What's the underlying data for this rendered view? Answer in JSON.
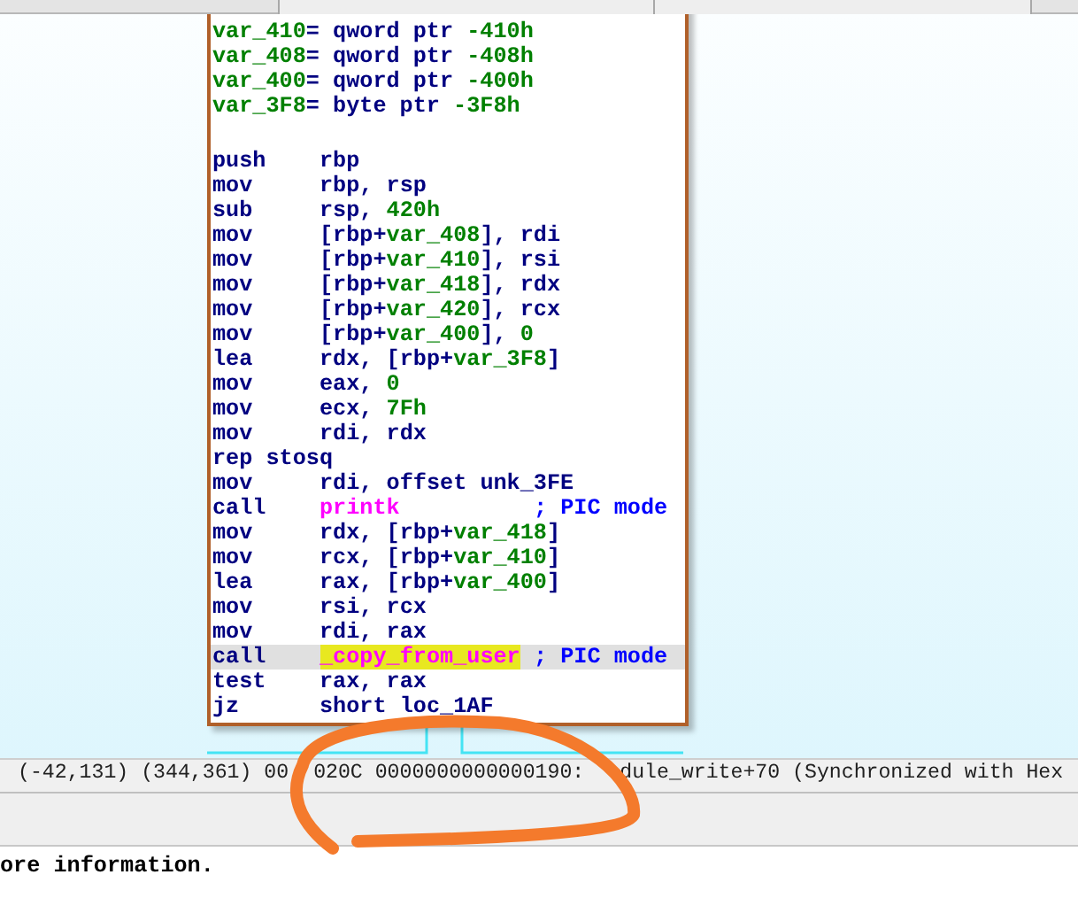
{
  "code_block": {
    "lines": [
      {
        "kind": "decl",
        "segments": [
          {
            "text": "var_410",
            "kind": "var"
          },
          {
            "text": "= qword ptr ",
            "kind": "plain"
          },
          {
            "text": "-410h",
            "kind": "num"
          }
        ]
      },
      {
        "kind": "decl",
        "segments": [
          {
            "text": "var_408",
            "kind": "var"
          },
          {
            "text": "= qword ptr ",
            "kind": "plain"
          },
          {
            "text": "-408h",
            "kind": "num"
          }
        ]
      },
      {
        "kind": "decl",
        "segments": [
          {
            "text": "var_400",
            "kind": "var"
          },
          {
            "text": "= qword ptr ",
            "kind": "plain"
          },
          {
            "text": "-400h",
            "kind": "num"
          }
        ]
      },
      {
        "kind": "decl",
        "segments": [
          {
            "text": "var_3F8",
            "kind": "var"
          },
          {
            "text": "= byte ptr ",
            "kind": "plain"
          },
          {
            "text": "-3F8h",
            "kind": "num"
          }
        ]
      },
      {
        "kind": "blank"
      },
      {
        "kind": "insn",
        "mnemonic": "push",
        "segments": [
          {
            "text": "rbp",
            "kind": "plain"
          }
        ]
      },
      {
        "kind": "insn",
        "mnemonic": "mov",
        "segments": [
          {
            "text": "rbp, rsp",
            "kind": "plain"
          }
        ]
      },
      {
        "kind": "insn",
        "mnemonic": "sub",
        "segments": [
          {
            "text": "rsp, ",
            "kind": "plain"
          },
          {
            "text": "420h",
            "kind": "num"
          }
        ]
      },
      {
        "kind": "insn",
        "mnemonic": "mov",
        "segments": [
          {
            "text": "[rbp+",
            "kind": "plain"
          },
          {
            "text": "var_408",
            "kind": "var"
          },
          {
            "text": "], rdi",
            "kind": "plain"
          }
        ]
      },
      {
        "kind": "insn",
        "mnemonic": "mov",
        "segments": [
          {
            "text": "[rbp+",
            "kind": "plain"
          },
          {
            "text": "var_410",
            "kind": "var"
          },
          {
            "text": "], rsi",
            "kind": "plain"
          }
        ]
      },
      {
        "kind": "insn",
        "mnemonic": "mov",
        "segments": [
          {
            "text": "[rbp+",
            "kind": "plain"
          },
          {
            "text": "var_418",
            "kind": "var"
          },
          {
            "text": "], rdx",
            "kind": "plain"
          }
        ]
      },
      {
        "kind": "insn",
        "mnemonic": "mov",
        "segments": [
          {
            "text": "[rbp+",
            "kind": "plain"
          },
          {
            "text": "var_420",
            "kind": "var"
          },
          {
            "text": "], rcx",
            "kind": "plain"
          }
        ]
      },
      {
        "kind": "insn",
        "mnemonic": "mov",
        "segments": [
          {
            "text": "[rbp+",
            "kind": "plain"
          },
          {
            "text": "var_400",
            "kind": "var"
          },
          {
            "text": "], ",
            "kind": "plain"
          },
          {
            "text": "0",
            "kind": "num"
          }
        ]
      },
      {
        "kind": "insn",
        "mnemonic": "lea",
        "segments": [
          {
            "text": "rdx, [rbp+",
            "kind": "plain"
          },
          {
            "text": "var_3F8",
            "kind": "var"
          },
          {
            "text": "]",
            "kind": "plain"
          }
        ]
      },
      {
        "kind": "insn",
        "mnemonic": "mov",
        "segments": [
          {
            "text": "eax, ",
            "kind": "plain"
          },
          {
            "text": "0",
            "kind": "num"
          }
        ]
      },
      {
        "kind": "insn",
        "mnemonic": "mov",
        "segments": [
          {
            "text": "ecx, ",
            "kind": "plain"
          },
          {
            "text": "7Fh",
            "kind": "num"
          }
        ]
      },
      {
        "kind": "insn",
        "mnemonic": "mov",
        "segments": [
          {
            "text": "rdi, rdx",
            "kind": "plain"
          }
        ]
      },
      {
        "kind": "insn",
        "mnemonic": "rep stosq"
      },
      {
        "kind": "insn",
        "mnemonic": "mov",
        "segments": [
          {
            "text": "rdi, offset unk_3FE",
            "kind": "plain"
          }
        ]
      },
      {
        "kind": "insn",
        "mnemonic": "call",
        "segments": [
          {
            "text": "printk",
            "kind": "func"
          }
        ],
        "comment": "; PIC mode"
      },
      {
        "kind": "insn",
        "mnemonic": "mov",
        "segments": [
          {
            "text": "rdx, [rbp+",
            "kind": "plain"
          },
          {
            "text": "var_418",
            "kind": "var"
          },
          {
            "text": "]",
            "kind": "plain"
          }
        ]
      },
      {
        "kind": "insn",
        "mnemonic": "mov",
        "segments": [
          {
            "text": "rcx, [rbp+",
            "kind": "plain"
          },
          {
            "text": "var_410",
            "kind": "var"
          },
          {
            "text": "]",
            "kind": "plain"
          }
        ]
      },
      {
        "kind": "insn",
        "mnemonic": "lea",
        "segments": [
          {
            "text": "rax, [rbp+",
            "kind": "plain"
          },
          {
            "text": "var_400",
            "kind": "var"
          },
          {
            "text": "]",
            "kind": "plain"
          }
        ]
      },
      {
        "kind": "insn",
        "mnemonic": "mov",
        "segments": [
          {
            "text": "rsi, rcx",
            "kind": "plain"
          }
        ]
      },
      {
        "kind": "insn",
        "mnemonic": "mov",
        "segments": [
          {
            "text": "rdi, rax",
            "kind": "plain"
          }
        ]
      },
      {
        "kind": "insn",
        "mnemonic": "call",
        "selected": true,
        "segments": [
          {
            "text": "_copy_from_user",
            "kind": "func_marked"
          }
        ],
        "comment": "; PIC mode"
      },
      {
        "kind": "insn",
        "mnemonic": "test",
        "segments": [
          {
            "text": "rax, rax",
            "kind": "plain"
          }
        ]
      },
      {
        "kind": "insn",
        "mnemonic": "jz",
        "segments": [
          {
            "text": "short loc_1AF",
            "kind": "plain"
          }
        ]
      }
    ]
  },
  "status_bar": {
    "parts": [
      "(-42,131) (344,361) 00",
      "020C 0000000000000190:",
      "dule_write+70 (Synchronized with Hex"
    ]
  },
  "output": {
    "text": "ore information."
  }
}
